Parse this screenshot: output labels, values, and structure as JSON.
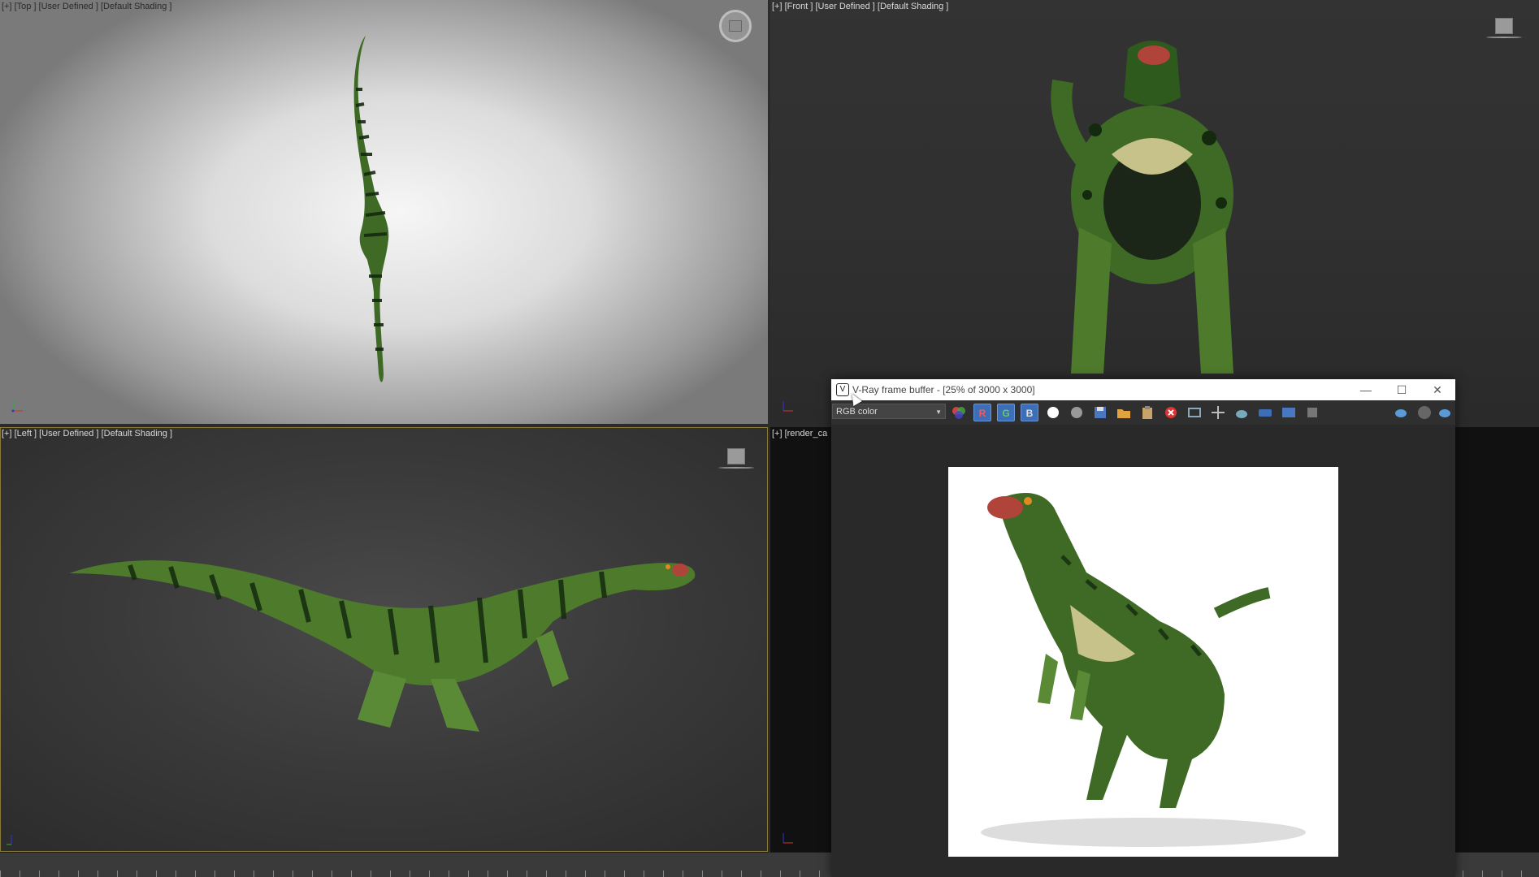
{
  "viewports": {
    "top": {
      "label": "[+] [Top ] [User Defined ] [Default Shading ]",
      "axis": "top-axis"
    },
    "front": {
      "label": "[+] [Front ] [User Defined ] [Default Shading ]",
      "axis": "front-axis"
    },
    "left": {
      "label": "[+] [Left ] [User Defined ] [Default Shading ]",
      "axis": "left-axis"
    },
    "camera": {
      "label": "[+] [render_ca",
      "axis": "camera-axis"
    }
  },
  "vfb": {
    "title": "V-Ray frame buffer - [25% of 3000 x 3000]",
    "channel": "RGB color",
    "buttons": {
      "r": "R",
      "g": "G",
      "b": "B"
    },
    "window_controls": {
      "minimize": "—",
      "maximize": "☐",
      "close": "✕"
    }
  },
  "colors": {
    "creature_green": "#4e7a2c",
    "creature_dark": "#1d3a16",
    "rgb_button": "#3c6fb8"
  }
}
